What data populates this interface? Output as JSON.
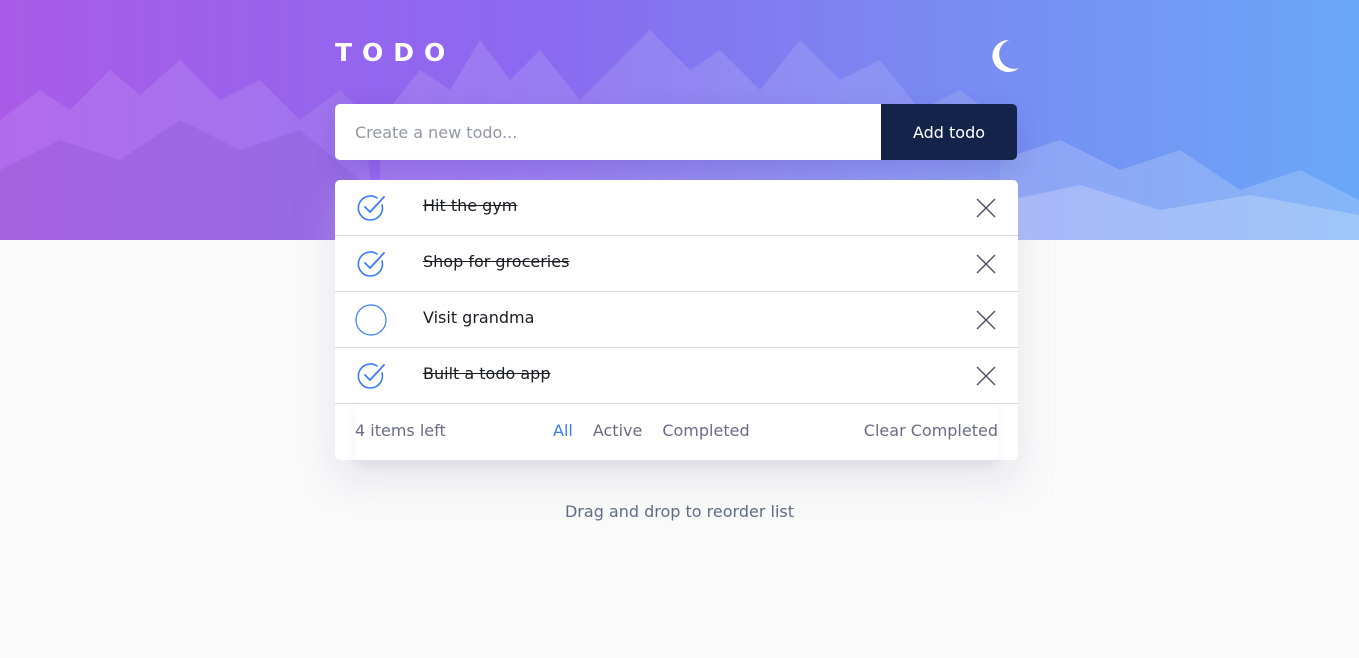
{
  "header": {
    "title": "TODO",
    "theme_icon": "moon-icon"
  },
  "new_todo": {
    "placeholder": "Create a new todo...",
    "value": "",
    "add_label": "Add todo"
  },
  "todos": [
    {
      "text": "Hit the gym",
      "completed": true
    },
    {
      "text": "Shop for groceries",
      "completed": true
    },
    {
      "text": "Visit grandma",
      "completed": false
    },
    {
      "text": "Built a todo app",
      "completed": true
    }
  ],
  "footer": {
    "items_left": "4 items left",
    "filters": [
      "All",
      "Active",
      "Completed"
    ],
    "active_filter": "All",
    "clear_label": "Clear Completed"
  },
  "hint": "Drag and drop to reorder list",
  "colors": {
    "accent": "#3a7bfd",
    "button_bg": "#14234a",
    "gradient_start": "#a95be8",
    "gradient_end": "#6aa7f7",
    "background": "#fafafa"
  }
}
